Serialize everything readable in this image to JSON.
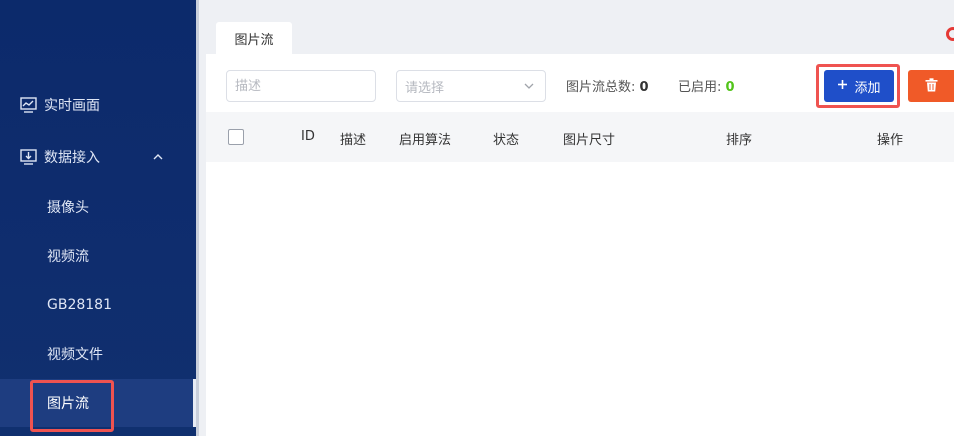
{
  "sidebar": {
    "realtime_label": "实时画面",
    "data_access_label": "数据接入",
    "sub_items": [
      {
        "label": "摄像头"
      },
      {
        "label": "视频流"
      },
      {
        "label": "GB28181"
      },
      {
        "label": "视频文件"
      },
      {
        "label": "图片流"
      }
    ]
  },
  "tabs": [
    {
      "label": "图片流"
    }
  ],
  "toolbar": {
    "desc_placeholder": "描述",
    "select_placeholder": "请选择",
    "total_label": "图片流总数:",
    "total_value": "0",
    "enabled_label": "已启用:",
    "enabled_value": "0",
    "add_label": "添加"
  },
  "table": {
    "headers": [
      "ID",
      "描述",
      "启用算法",
      "状态",
      "图片尺寸",
      "排序",
      "操作"
    ]
  },
  "colors": {
    "sidebar_bg": "#0f2d6e",
    "primary": "#1f4fc9",
    "danger": "#f05a28",
    "highlight": "#ef5350",
    "enabled_count": "#52c41a"
  },
  "icons": {
    "realtime": "chart-monitor-icon",
    "data_access": "monitor-download-icon",
    "expand": "chevron-up-icon",
    "select": "chevron-down-icon",
    "add": "plus-icon",
    "delete": "trash-icon"
  }
}
